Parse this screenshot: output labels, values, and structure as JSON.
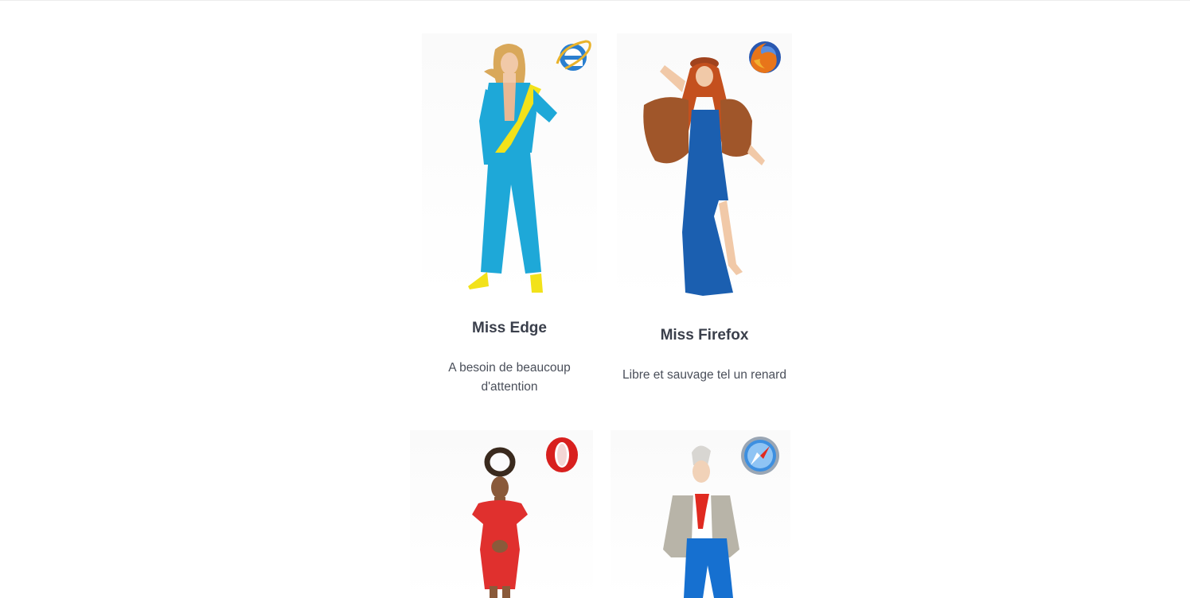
{
  "gallery": {
    "items": [
      {
        "name": "Miss Edge",
        "description": "A besoin de beaucoup d'attention",
        "browser_icon": "internet-explorer-icon",
        "outfit_colors": {
          "suit": "#1ea8d8",
          "sash": "#f2e21a",
          "hair": "#d9a85a"
        }
      },
      {
        "name": "Miss Firefox",
        "description": "Libre et sauvage tel un renard",
        "browser_icon": "firefox-icon",
        "outfit_colors": {
          "dress": "#1b5fb0",
          "fur": "#a0562a",
          "hair": "#c4501e"
        }
      },
      {
        "name": "",
        "description": "",
        "browser_icon": "opera-icon",
        "outfit_colors": {
          "dress": "#e0302e",
          "hair": "#2a2018"
        }
      },
      {
        "name": "",
        "description": "",
        "browser_icon": "safari-icon",
        "outfit_colors": {
          "pants": "#1670d0",
          "jacket": "#b8b4a8",
          "scarf": "#e02a20"
        }
      }
    ]
  }
}
